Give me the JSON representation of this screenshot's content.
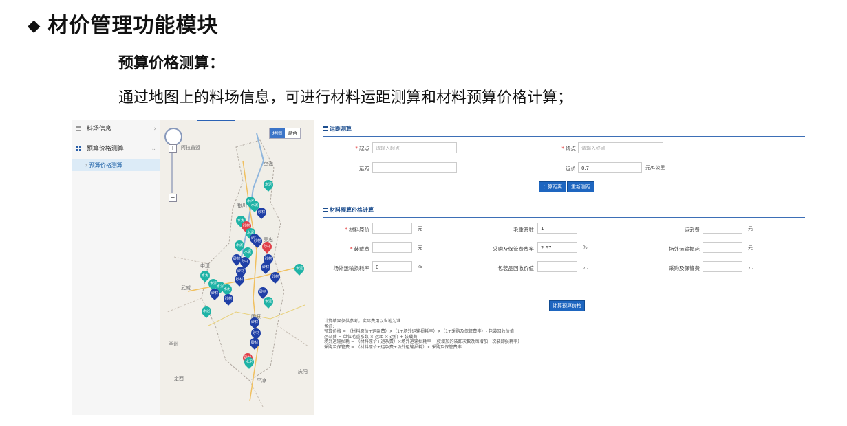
{
  "slide": {
    "title": "材价管理功能模块",
    "subtitle": "预算价格测算：",
    "description": "通过地图上的料场信息，可进行材料运距测算和材料预算价格计算；"
  },
  "sidebar": {
    "items": [
      {
        "label": "料场信息"
      },
      {
        "label": "预算价格测算"
      }
    ],
    "sub_item": "预算价格测算"
  },
  "map": {
    "toggle": [
      "地图",
      "混合"
    ],
    "labels": [
      "阿拉善盟",
      "乌海",
      "银川",
      "吴忠",
      "固原",
      "平凉",
      "定西",
      "庆阳",
      "中卫",
      "武威",
      "兰州"
    ],
    "marker_labels": [
      "砂材",
      "水泥"
    ]
  },
  "distance": {
    "section_title": "运距测算",
    "start_label": "起点",
    "start_placeholder": "请输入起点",
    "end_label": "终点",
    "end_placeholder": "请输入终点",
    "distance_label": "运距",
    "freight_label": "运价",
    "freight_value": "0.7",
    "freight_unit": "元/t.公里",
    "calc_button": "计算距离",
    "reset_button": "重新测距"
  },
  "budget": {
    "section_title": "材料预算价格计算",
    "fields": {
      "orig_price_label": "材料原价",
      "orig_price_unit": "元",
      "gross_coef_label": "毛重系数",
      "gross_coef_value": "1",
      "misc_fee_label": "运杂费",
      "misc_fee_unit": "元",
      "loading_fee_label": "装载费",
      "loading_fee_unit": "元",
      "storage_rate_label": "采购及保管费费率",
      "storage_rate_value": "2.67",
      "storage_rate_unit": "%",
      "outside_loss_label": "场外运输损耗",
      "outside_loss_unit": "元",
      "outside_loss_rate_label": "场外运输损耗率",
      "outside_loss_rate_value": "0",
      "outside_loss_rate_unit": "%",
      "package_label": "包装品回收价值",
      "package_unit": "元",
      "storage_fee_label": "采购及保管费",
      "storage_fee_unit": "元"
    },
    "calc_button": "计算预算价格"
  },
  "notes": [
    "计算结果仅供参考，实际费用以当地为准",
    "备注:",
    "预算价格 = （材料原价+运杂费）×（1+场外运输损耗率）×（1+采购及保管费率）- 包装回收价值",
    "运杂费 = 单位毛重系数 × 运距 × 运价 + 装载费",
    "场外运输损耗 = （材料原价+运杂费）×场外运输损耗率 （按增加的装卸次数及每增加一次装卸损耗率）",
    "采购及保管费 = （材料原价+运杂费+场外运输损耗）× 采购及保管费率"
  ]
}
